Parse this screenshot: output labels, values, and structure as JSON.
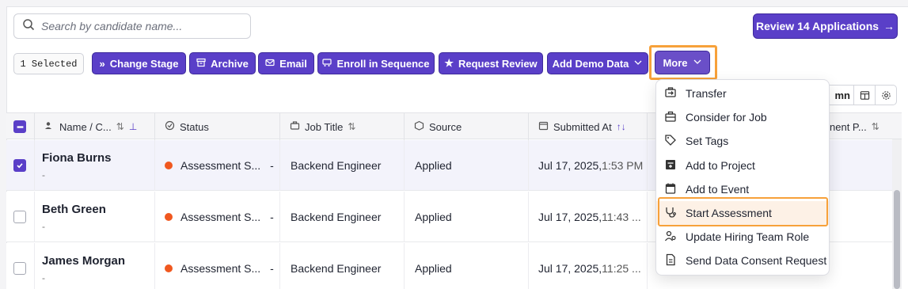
{
  "search": {
    "placeholder": "Search by candidate name..."
  },
  "review_button": {
    "label": "Review 14 Applications",
    "arrow": "→"
  },
  "toolbar": {
    "selected": "1 Selected",
    "change_stage": "Change Stage",
    "archive": "Archive",
    "email": "Email",
    "enroll": "Enroll in Sequence",
    "request_review": "Request Review",
    "add_demo": "Add Demo Data",
    "more": "More"
  },
  "column_control": {
    "label": "mn"
  },
  "table": {
    "headers": {
      "name": "Name / C...",
      "status": "Status",
      "job_title": "Job Title",
      "source": "Source",
      "submitted_at": "Submitted At",
      "extra": "nent P..."
    },
    "rows": [
      {
        "name": "Fiona Burns",
        "sub": "-",
        "status": "Assessment S...",
        "status_extra": "-",
        "job": "Backend Engineer",
        "source": "Applied",
        "date": "Jul 17, 2025,",
        "time": "1:53 PM",
        "checked": true
      },
      {
        "name": "Beth Green",
        "sub": "-",
        "status": "Assessment S...",
        "status_extra": "-",
        "job": "Backend Engineer",
        "source": "Applied",
        "date": "Jul 17, 2025,",
        "time": "11:43 ...",
        "checked": false
      },
      {
        "name": "James Morgan",
        "sub": "-",
        "status": "Assessment S...",
        "status_extra": "-",
        "job": "Backend Engineer",
        "source": "Applied",
        "date": "Jul 17, 2025,",
        "time": "11:25 ...",
        "checked": false
      }
    ]
  },
  "more_menu": {
    "items": [
      {
        "label": "Transfer",
        "icon": "transfer-icon"
      },
      {
        "label": "Consider for Job",
        "icon": "briefcase-icon"
      },
      {
        "label": "Set Tags",
        "icon": "tag-icon"
      },
      {
        "label": "Add to Project",
        "icon": "project-icon"
      },
      {
        "label": "Add to Event",
        "icon": "calendar-icon"
      },
      {
        "label": "Start Assessment",
        "icon": "stethoscope-icon"
      },
      {
        "label": "Update Hiring Team Role",
        "icon": "team-icon"
      },
      {
        "label": "Send Data Consent Request",
        "icon": "document-icon"
      }
    ]
  },
  "colors": {
    "accent": "#5a3fc8",
    "highlight": "#f7a13a",
    "status_dot": "#f0581f"
  }
}
